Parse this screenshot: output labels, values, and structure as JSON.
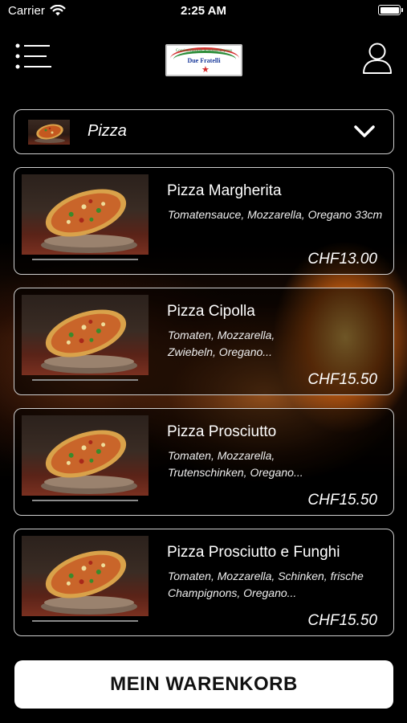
{
  "status_bar": {
    "carrier": "Carrier",
    "time": "2:25 AM"
  },
  "header": {
    "logo": {
      "tagline": "Cousins Pizza & Schnitzel Express",
      "name": "Due Fratelli"
    },
    "icons": {
      "menu": "menu-icon",
      "profile": "user-profile-icon"
    }
  },
  "category": {
    "selected": "Pizza"
  },
  "products": [
    {
      "name": "Pizza Margherita",
      "description": "Tomatensauce, Mozzarella, Oregano 33cm",
      "price": "CHF13.00"
    },
    {
      "name": "Pizza Cipolla",
      "description": "Tomaten, Mozzarella, Zwiebeln, Oregano...",
      "price": "CHF15.50"
    },
    {
      "name": "Pizza Prosciutto",
      "description": "Tomaten, Mozzarella, Trutenschinken, Oregano...",
      "price": "CHF15.50"
    },
    {
      "name": "Pizza Prosciutto e Funghi",
      "description": "Tomaten, Mozzarella, Schinken, frische Champignons, Oregano...",
      "price": "CHF15.50"
    }
  ],
  "cart": {
    "label": "MEIN WARENKORB"
  },
  "colors": {
    "background": "#000000",
    "border": "#cfcfcf",
    "button_bg": "#ffffff",
    "button_text": "#111111"
  }
}
